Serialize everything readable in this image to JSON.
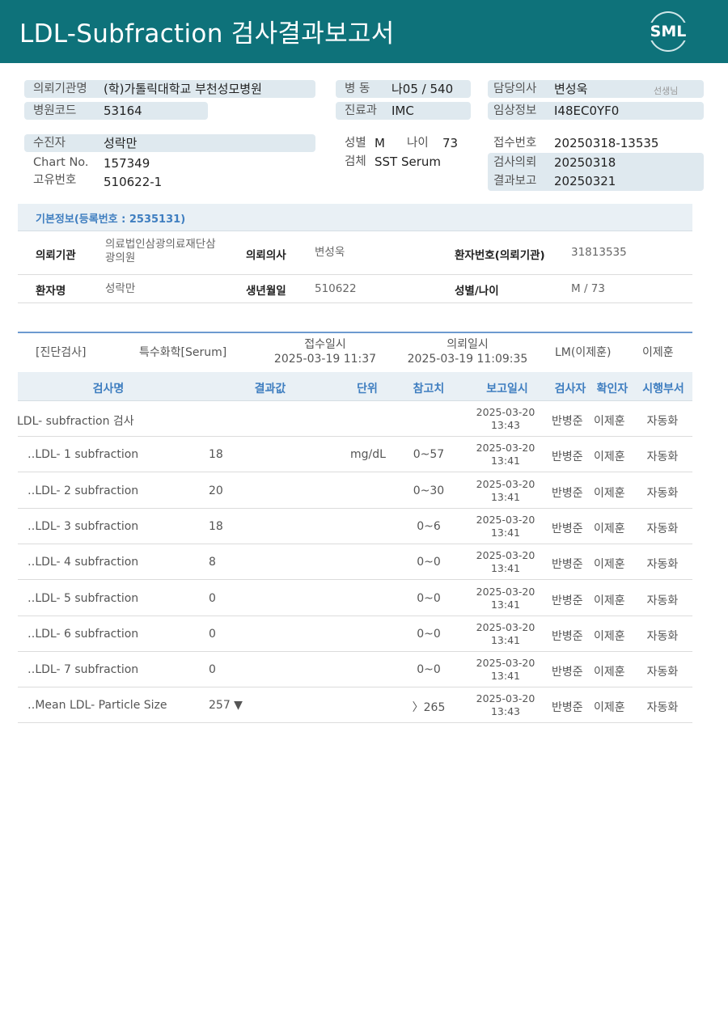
{
  "header": {
    "title": "LDL-Subfraction 검사결과보고서",
    "logo": "SML"
  },
  "patient_info": {
    "org_label": "의뢰기관명",
    "org_value": "(학)가톨릭대학교 부천성모병원",
    "code_label": "병원코드",
    "code_value": "53164",
    "ward_label": "병 동",
    "ward_value": "나05 / 540",
    "dept_label": "진료과",
    "dept_value": "IMC",
    "doctor_label": "담당의사",
    "doctor_value": "변성욱",
    "doctor_suffix": "선생님",
    "clinical_label": "임상정보",
    "clinical_value": "I48EC0YF0",
    "patient_label": "수진자",
    "patient_value": "성락만",
    "chart_label": "Chart No.",
    "chart_value": "157349",
    "id_label": "고유번호",
    "id_value": "510622-1",
    "sex_label": "성별",
    "sex_value": "M",
    "age_label": "나이",
    "age_value": "73",
    "specimen_label": "검체",
    "specimen_value": "SST Serum",
    "receipt_label": "접수번호",
    "receipt_value": "20250318-13535",
    "request_label": "검사의뢰",
    "request_value": "20250318",
    "report_label": "결과보고",
    "report_value": "20250321"
  },
  "basic_info": {
    "title": "기본정보(등록번호 : 2535131)",
    "rows": [
      [
        {
          "key": "의뢰기관",
          "value": "의료법인삼광의료재단삼\n광의원"
        },
        {
          "key": "의뢰의사",
          "value": "변성욱"
        },
        {
          "key": "환자번호(의뢰기관)",
          "value": "31813535"
        }
      ],
      [
        {
          "key": "환자명",
          "value": "성락만"
        },
        {
          "key": "생년월일",
          "value": "510622"
        },
        {
          "key": "성별/나이",
          "value": "M / 73"
        }
      ]
    ]
  },
  "results": {
    "category": "[진단검사]",
    "sub_category": "특수화학[Serum]",
    "receipt_label": "접수일시",
    "receipt_time": "2025-03-19 11:37",
    "request_label": "의뢰일시",
    "request_time": "2025-03-19 11:09:35",
    "lm": "LM(이제훈)",
    "lm_name": "이제훈",
    "columns": [
      "검사명",
      "결과값",
      "단위",
      "참고치",
      "보고일시",
      "검사자",
      "확인자",
      "시행부서"
    ],
    "rows": [
      {
        "name": "LDL- subfraction 검사",
        "value": "",
        "unit": "",
        "ref": "",
        "date": "2025-03-20",
        "time": "13:43",
        "tech": "반병준",
        "conf": "이제훈",
        "dept": "자동화"
      },
      {
        "name": "‥LDL- 1 subfraction",
        "value": "18",
        "unit": "mg/dL",
        "ref": "0~57",
        "date": "2025-03-20",
        "time": "13:41",
        "tech": "반병준",
        "conf": "이제훈",
        "dept": "자동화"
      },
      {
        "name": "‥LDL- 2 subfraction",
        "value": "20",
        "unit": "",
        "ref": "0~30",
        "date": "2025-03-20",
        "time": "13:41",
        "tech": "반병준",
        "conf": "이제훈",
        "dept": "자동화"
      },
      {
        "name": "‥LDL- 3 subfraction",
        "value": "18",
        "unit": "",
        "ref": "0~6",
        "date": "2025-03-20",
        "time": "13:41",
        "tech": "반병준",
        "conf": "이제훈",
        "dept": "자동화"
      },
      {
        "name": "‥LDL- 4 subfraction",
        "value": "8",
        "unit": "",
        "ref": "0~0",
        "date": "2025-03-20",
        "time": "13:41",
        "tech": "반병준",
        "conf": "이제훈",
        "dept": "자동화"
      },
      {
        "name": "‥LDL- 5 subfraction",
        "value": "0",
        "unit": "",
        "ref": "0~0",
        "date": "2025-03-20",
        "time": "13:41",
        "tech": "반병준",
        "conf": "이제훈",
        "dept": "자동화"
      },
      {
        "name": "‥LDL- 6 subfraction",
        "value": "0",
        "unit": "",
        "ref": "0~0",
        "date": "2025-03-20",
        "time": "13:41",
        "tech": "반병준",
        "conf": "이제훈",
        "dept": "자동화"
      },
      {
        "name": "‥LDL- 7 subfraction",
        "value": "0",
        "unit": "",
        "ref": "0~0",
        "date": "2025-03-20",
        "time": "13:41",
        "tech": "반병준",
        "conf": "이제훈",
        "dept": "자동화"
      },
      {
        "name": "‥Mean LDL- Particle Size",
        "value": "257 ▼",
        "unit": "",
        "ref": "〉265",
        "date": "2025-03-20",
        "time": "13:43",
        "tech": "반병준",
        "conf": "이제훈",
        "dept": "자동화"
      }
    ]
  }
}
